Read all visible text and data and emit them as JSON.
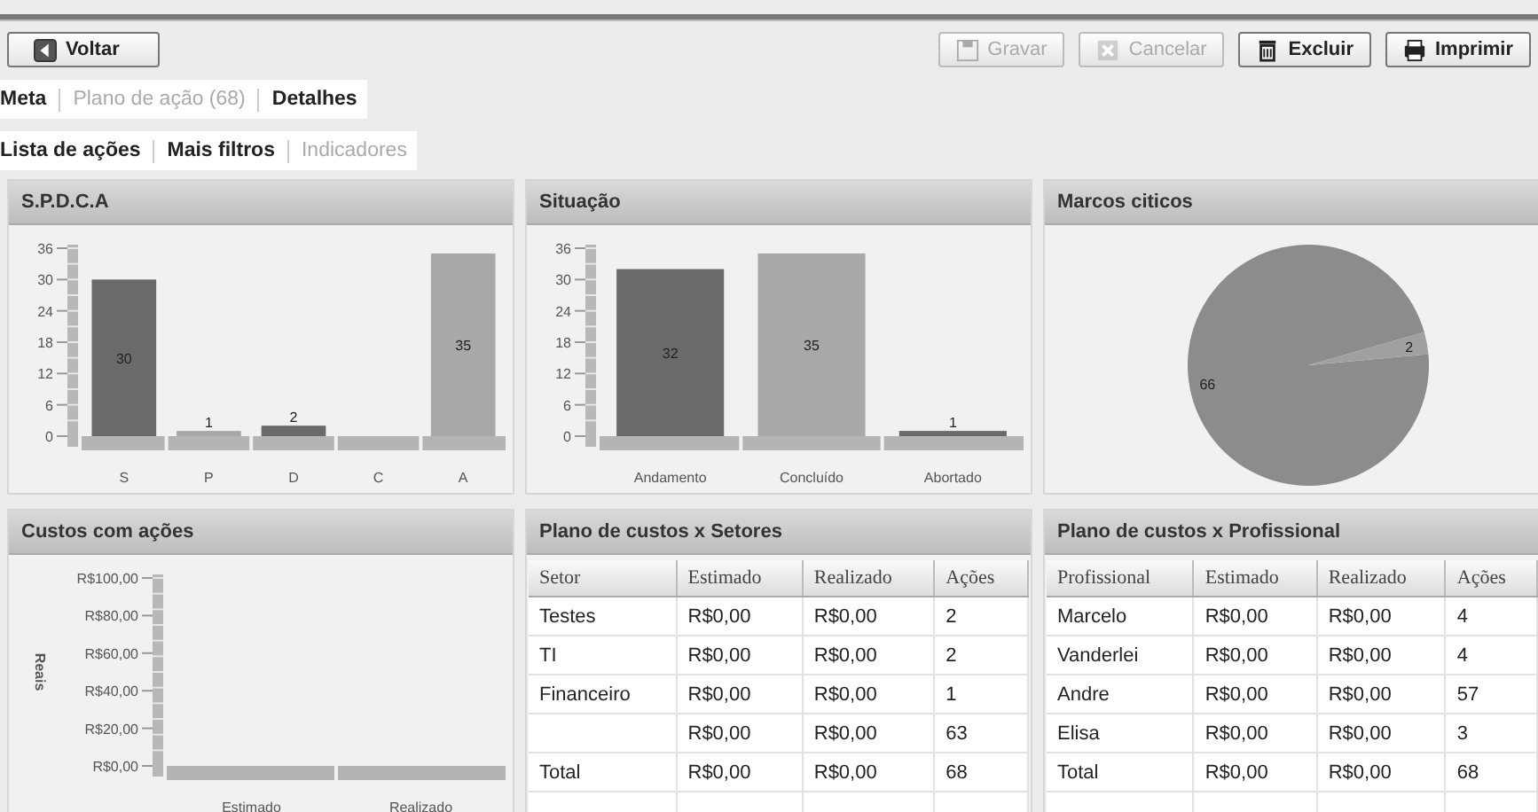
{
  "toolbar": {
    "back_button": {
      "label": "Voltar"
    },
    "buttons": [
      {
        "label": "Gravar",
        "kind": "save",
        "disabled": true
      },
      {
        "label": "Cancelar",
        "kind": "cancel",
        "disabled": true
      },
      {
        "label": "Excluir",
        "kind": "delete",
        "disabled": false
      },
      {
        "label": "Imprimir",
        "kind": "print",
        "disabled": false
      }
    ]
  },
  "tabs": [
    {
      "label": "Meta",
      "disabled": false
    },
    {
      "label": "Plano de ação (68)",
      "disabled": true
    },
    {
      "label": "Detalhes",
      "disabled": false
    }
  ],
  "subtabs": [
    {
      "label": "Lista de ações",
      "disabled": false
    },
    {
      "label": "Mais filtros",
      "disabled": false
    },
    {
      "label": "Indicadores",
      "disabled": true
    }
  ],
  "panels": [
    {
      "title": "S.P.D.C.A",
      "kind": "chart",
      "chart_data": {
        "type": "bar",
        "categories": [
          "S",
          "P",
          "D",
          "C",
          "A"
        ],
        "colors": [
          "#6a6a6a",
          "#a8a8a8",
          "#6a6a6a",
          null,
          "#a8a8a8"
        ],
        "values": [
          30,
          1,
          2,
          null,
          35
        ],
        "ylim": [
          0,
          36
        ],
        "yticks": [
          0,
          6,
          12,
          18,
          24,
          30,
          36
        ],
        "data_labels": true
      }
    },
    {
      "title": "Situação",
      "kind": "chart",
      "chart_data": {
        "type": "bar",
        "categories": [
          "Andamento",
          "Concluído",
          "Abortado"
        ],
        "colors": [
          "#6a6a6a",
          "#a8a8a8",
          "#6a6a6a"
        ],
        "values": [
          32,
          35,
          1
        ],
        "ylim": [
          0,
          36
        ],
        "yticks": [
          0,
          6,
          12,
          18,
          24,
          30,
          36
        ],
        "data_labels": true
      }
    },
    {
      "title": "Marcos citicos",
      "kind": "chart",
      "chart_data": {
        "type": "pie",
        "colors": [
          "#8c8c8c",
          "#a0a0a0"
        ],
        "values": [
          66,
          2
        ],
        "data_labels": true
      }
    },
    {
      "title": "Custos com ações",
      "kind": "axes",
      "ylabel": "Reais",
      "categories": [
        "Estimado",
        "Realizado"
      ],
      "ytick_labels": [
        "R$100,00",
        "R$80,00",
        "R$60,00",
        "R$40,00",
        "R$20,00",
        "R$0,00"
      ]
    },
    {
      "title": "Plano de custos x Setores",
      "kind": "table",
      "columns": [
        "Setor",
        "Estimado",
        "Realizado",
        "Ações"
      ],
      "rows": [
        [
          "Testes",
          "R$0,00",
          "R$0,00",
          "2"
        ],
        [
          "TI",
          "R$0,00",
          "R$0,00",
          "2"
        ],
        [
          "Financeiro",
          "R$0,00",
          "R$0,00",
          "1"
        ],
        [
          "",
          "R$0,00",
          "R$0,00",
          "63"
        ],
        [
          "Total",
          "R$0,00",
          "R$0,00",
          "68"
        ]
      ]
    },
    {
      "title": "Plano de custos x Profissional",
      "kind": "table",
      "columns": [
        "Profissional",
        "Estimado",
        "Realizado",
        "Ações"
      ],
      "rows": [
        [
          "Marcelo",
          "R$0,00",
          "R$0,00",
          "4"
        ],
        [
          "Vanderlei",
          "R$0,00",
          "R$0,00",
          "4"
        ],
        [
          "Andre",
          "R$0,00",
          "R$0,00",
          "57"
        ],
        [
          "Elisa",
          "R$0,00",
          "R$0,00",
          "3"
        ],
        [
          "Total",
          "R$0,00",
          "R$0,00",
          "68"
        ]
      ]
    }
  ]
}
